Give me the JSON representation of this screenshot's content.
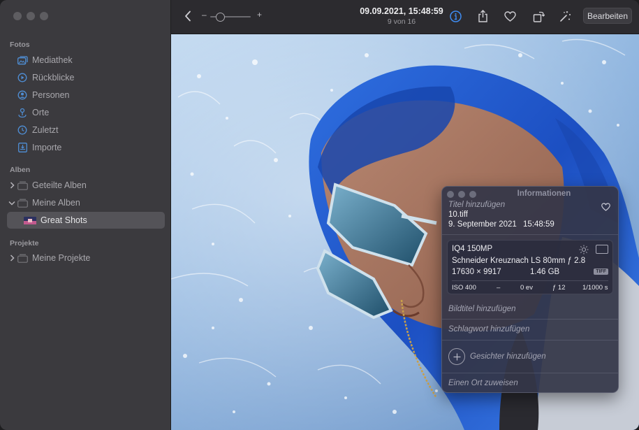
{
  "sidebar": {
    "sections": {
      "fotos": "Fotos",
      "alben": "Alben",
      "projekte": "Projekte"
    },
    "items": {
      "mediathek": "Mediathek",
      "rueckblicke": "Rückblicke",
      "personen": "Personen",
      "orte": "Orte",
      "zuletzt": "Zuletzt",
      "importe": "Importe",
      "geteilte_alben": "Geteilte Alben",
      "meine_alben": "Meine Alben",
      "great_shots": "Great Shots",
      "meine_projekte": "Meine Projekte"
    }
  },
  "toolbar": {
    "date": "09.09.2021, 15:48:59",
    "position": "9 von 16",
    "zoom_minus": "–",
    "zoom_plus": "+",
    "zoom_level": 0.25,
    "edit_label": "Bearbeiten"
  },
  "info": {
    "window_title": "Informationen",
    "title_placeholder": "Titel hinzufügen",
    "filename": "10.tiff",
    "date": "9. September 2021",
    "time": "15:48:59",
    "camera": "IQ4 150MP",
    "lens": "Schneider Kreuznach LS 80mm ƒ 2.8",
    "dimensions": "17630 × 9917",
    "filesize": "1.46 GB",
    "format": "TIFF",
    "exif": {
      "iso": "ISO 400",
      "focal": "–",
      "exposure": "0 ev",
      "aperture": "ƒ 12",
      "shutter": "1/1000 s"
    },
    "caption_placeholder": "Bildtitel hinzufügen",
    "keyword_placeholder": "Schlagwort hinzufügen",
    "faces_placeholder": "Gesichter hinzufügen",
    "location_placeholder": "Einen Ort zuweisen"
  },
  "colors": {
    "accent": "#3f8cf2",
    "sidebar_bg": "#3b3a3e",
    "toolbar_bg": "#2c2b2f",
    "sidebar_icon": "#4f8fd6"
  }
}
